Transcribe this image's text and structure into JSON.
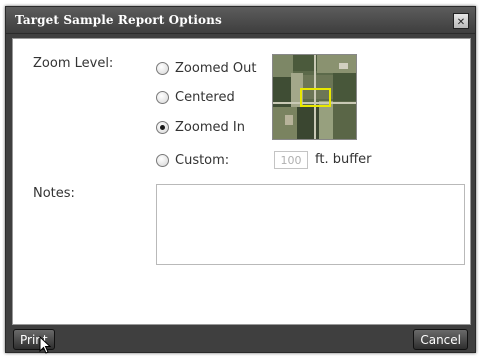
{
  "dialog": {
    "title": "Target Sample Report Options",
    "close_glyph": "✕"
  },
  "zoom": {
    "label": "Zoom Level:",
    "options": [
      {
        "label": "Zoomed Out",
        "checked": false
      },
      {
        "label": "Centered",
        "checked": false
      },
      {
        "label": "Zoomed In",
        "checked": true
      },
      {
        "label": "Custom:",
        "checked": false
      }
    ],
    "buffer_value": "100",
    "buffer_unit": "ft. buffer",
    "thumbnail_icon": "aerial-map-thumbnail"
  },
  "notes": {
    "label": "Notes:",
    "value": ""
  },
  "footer": {
    "print_label": "Print",
    "cancel_label": "Cancel"
  },
  "colors": {
    "chrome": "#3f3f3f",
    "highlight_box": "#e8e800"
  }
}
